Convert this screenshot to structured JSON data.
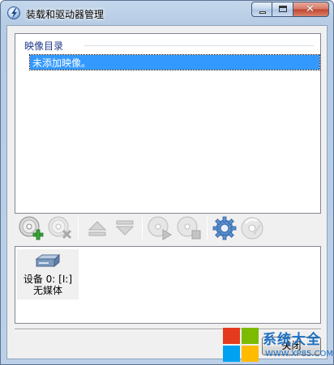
{
  "window": {
    "title": "装载和驱动器管理",
    "caption": {
      "minimize": "minimize",
      "maximize": "maximize",
      "close": "✕"
    }
  },
  "image_list": {
    "header": "映像目录",
    "items": [
      {
        "label": "未添加映像。",
        "selected": true
      }
    ]
  },
  "toolbar": {
    "buttons": [
      {
        "icon": "add-image-icon",
        "enabled": true
      },
      {
        "icon": "remove-image-icon",
        "enabled": false
      },
      {
        "icon": "move-up-icon",
        "enabled": false
      },
      {
        "icon": "move-down-icon",
        "enabled": false
      },
      {
        "icon": "mount-play-icon",
        "enabled": false
      },
      {
        "icon": "unmount-stop-icon",
        "enabled": false
      },
      {
        "icon": "settings-gear-icon",
        "enabled": true
      },
      {
        "icon": "disc-icon",
        "enabled": false
      }
    ]
  },
  "devices": [
    {
      "icon": "drive-icon",
      "label": "设备 0: [I:] 无媒体"
    }
  ],
  "footer": {
    "close_label": "关闭"
  },
  "watermark": {
    "brand": "系统大全",
    "url": "WWW.XP85.COM"
  },
  "colors": {
    "accent": "#3399ff",
    "header_text": "#1e3a8a",
    "titlebar": "#b6cbe4",
    "watermark_blue": "#1b6fc2",
    "logo": [
      "#e63a1e",
      "#7cbb00",
      "#00a1f1",
      "#ffbb00"
    ]
  }
}
